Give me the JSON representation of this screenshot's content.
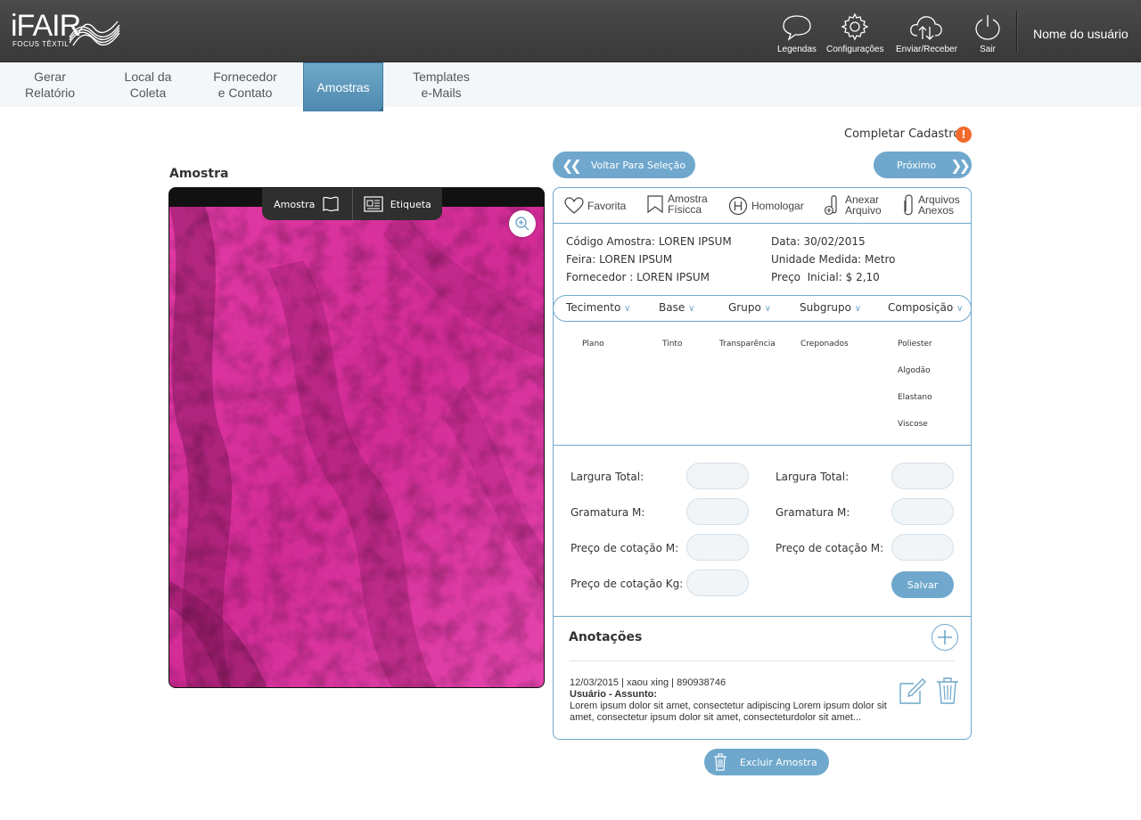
{
  "brand": {
    "name": "iFAIR",
    "tagline": "FOCUS TÊXTIL"
  },
  "header": {
    "buttons": [
      {
        "label": "Legendas",
        "icon": "chat-bubble-icon"
      },
      {
        "label": "Configurações",
        "icon": "gear-icon"
      },
      {
        "label": "Enviar/Receber",
        "icon": "cloud-sync-icon"
      },
      {
        "label": "Sair",
        "icon": "power-icon"
      }
    ],
    "user_name": "Nome do usuário"
  },
  "nav": {
    "tabs": [
      {
        "label": "Gerar\nRelatório",
        "active": false
      },
      {
        "label": "Local da\nColeta",
        "active": false
      },
      {
        "label": "Fornecedor\ne Contato",
        "active": false
      },
      {
        "label": "Amostras",
        "active": true
      },
      {
        "label": "Templates\ne-Mails",
        "active": false
      }
    ]
  },
  "completar_cadastro": {
    "label": "Completar Cadastro",
    "badge": "!"
  },
  "sample_panel": {
    "title": "Amostra",
    "tabs": [
      {
        "label": "Amostra",
        "icon": "flag-icon"
      },
      {
        "label": "Etiqueta",
        "icon": "label-card-icon"
      }
    ],
    "image": {
      "subject": "pink crinkled fabric",
      "color": "#e33aa8"
    }
  },
  "navigation": {
    "back_label": "Voltar Para Seleção",
    "next_label": "Próximo"
  },
  "actions": [
    {
      "label": "Favorita",
      "icon": "heart-icon"
    },
    {
      "label": "Amostra\nFísicca",
      "icon": "bookmark-icon"
    },
    {
      "label": "Homologar",
      "icon": "h-circle-icon"
    },
    {
      "label": "Anexar\nArquivo",
      "icon": "attach-add-icon"
    },
    {
      "label": "Arquivos\nAnexos",
      "icon": "paperclip-icon"
    }
  ],
  "info": {
    "codigo": {
      "label": "Código Amostra:",
      "value": "LOREN IPSUM"
    },
    "feira": {
      "label": "Feira:",
      "value": "LOREN IPSUM"
    },
    "fornecedor": {
      "label": "Fornecedor :",
      "value": "LOREN IPSUM"
    },
    "data": {
      "label": "Data:",
      "value": "30/02/2015"
    },
    "unidade": {
      "label": "Unidade Medida:",
      "value": "Metro"
    },
    "preco": {
      "label": "Preço  Inicial:",
      "value": "$ 2,10"
    }
  },
  "filters": [
    {
      "label": "Tecimento",
      "options": [
        "Plano"
      ]
    },
    {
      "label": "Base",
      "options": [
        "Tinto"
      ]
    },
    {
      "label": "Grupo",
      "options": [
        "Transparência"
      ]
    },
    {
      "label": "Subgrupo",
      "options": [
        "Creponados"
      ]
    },
    {
      "label": "Composição",
      "options": [
        "Poliester",
        "Algodão",
        "Elastano",
        "Viscose"
      ]
    }
  ],
  "fields": {
    "left": [
      "Largura Total:",
      "Gramatura M:",
      "Preço de cotação M:",
      "Preço de cotação Kg:"
    ],
    "right": [
      "Largura Total:",
      "Gramatura M:",
      "Preço de cotação M:"
    ],
    "save_label": "Salvar"
  },
  "annotations": {
    "title": "Anotações",
    "notes": [
      {
        "meta": "12/03/2015 | xaou xing | 890938746",
        "subject": "Usuário - Assunto:",
        "body": "Lorem ipsum dolor sit amet, consectetur adipiscing Lorem ipsum dolor sit amet, consectetur ipsum dolor sit amet, consecteturdolor sit amet..."
      }
    ]
  },
  "delete_label": "Excluir Amostra",
  "colors": {
    "accent": "#6fa8cc",
    "header": "#3f3f3f",
    "warning": "#f26a2c",
    "fabric": "#e33aa8"
  }
}
